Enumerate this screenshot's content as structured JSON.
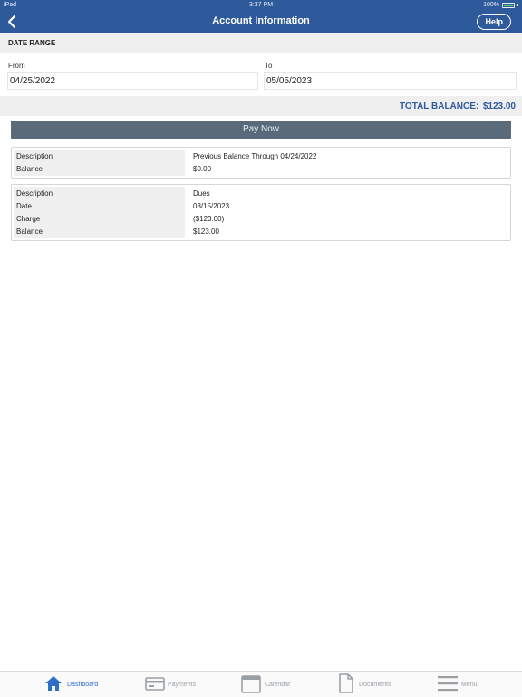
{
  "status_bar": {
    "device": "iPad",
    "time": "3:37 PM",
    "battery": "100%"
  },
  "nav": {
    "title": "Account Information",
    "help_label": "Help"
  },
  "date_range": {
    "header": "DATE RANGE",
    "from_label": "From",
    "from_value": "04/25/2022",
    "to_label": "To",
    "to_value": "05/05/2023"
  },
  "total": {
    "label": "TOTAL BALANCE:",
    "value": "$123.00"
  },
  "pay_now_label": "Pay Now",
  "entries": [
    {
      "rows": [
        {
          "label": "Description",
          "value": "Previous Balance Through 04/24/2022"
        },
        {
          "label": "Balance",
          "value": "$0.00"
        }
      ]
    },
    {
      "rows": [
        {
          "label": "Description",
          "value": "Dues"
        },
        {
          "label": "Date",
          "value": "03/15/2023"
        },
        {
          "label": "Charge",
          "value": "($123.00)"
        },
        {
          "label": "Balance",
          "value": "$123.00"
        }
      ]
    }
  ],
  "tabs": [
    {
      "label": "Dashboard",
      "icon": "home-icon",
      "active": true
    },
    {
      "label": "Payments",
      "icon": "credit-card-icon",
      "active": false
    },
    {
      "label": "Calendar",
      "icon": "calendar-icon",
      "active": false
    },
    {
      "label": "Documents",
      "icon": "document-icon",
      "active": false
    },
    {
      "label": "Menu",
      "icon": "menu-icon",
      "active": false
    }
  ],
  "colors": {
    "brand": "#2e5a9c",
    "accent_active": "#2e6fc7",
    "pay_button": "#5b6a7a"
  }
}
